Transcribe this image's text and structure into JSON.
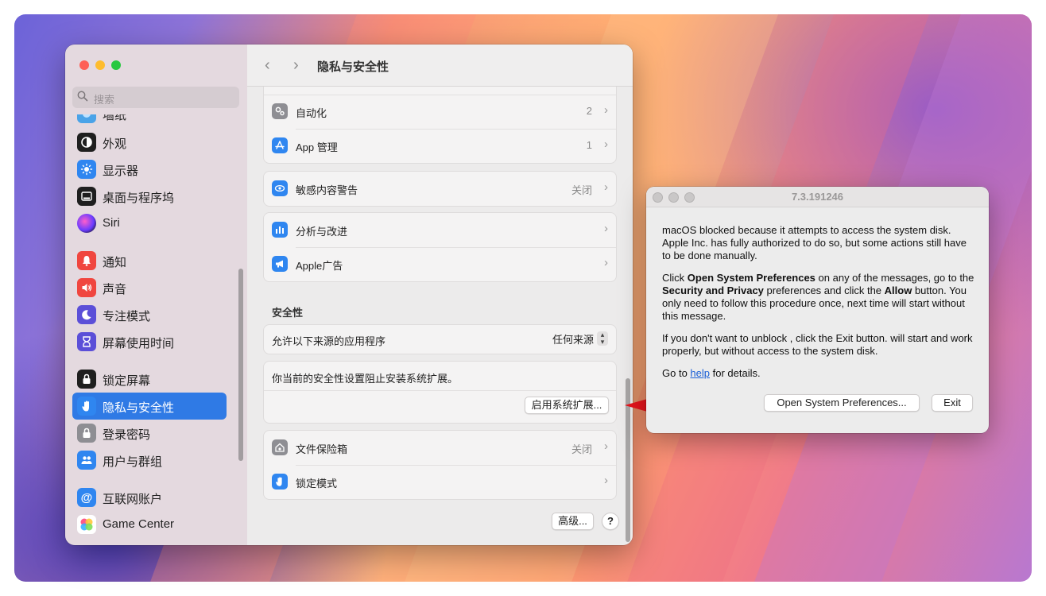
{
  "settings": {
    "search_placeholder": "搜索",
    "window_title": "隐私与安全性",
    "nav_back": "‹",
    "nav_forward": "›",
    "sidebar": {
      "partial_item": "墙纸",
      "items": [
        {
          "label": "外观",
          "icon": "appearance-icon"
        },
        {
          "label": "显示器",
          "icon": "display-icon"
        },
        {
          "label": "桌面与程序坞",
          "icon": "dock-icon"
        },
        {
          "label": "Siri",
          "icon": "siri-icon"
        },
        {
          "label": "通知",
          "icon": "notifications-icon"
        },
        {
          "label": "声音",
          "icon": "sound-icon"
        },
        {
          "label": "专注模式",
          "icon": "focus-icon"
        },
        {
          "label": "屏幕使用时间",
          "icon": "screen-time-icon"
        },
        {
          "label": "锁定屏幕",
          "icon": "lock-screen-icon"
        },
        {
          "label": "隐私与安全性",
          "icon": "privacy-hand-icon",
          "selected": true
        },
        {
          "label": "登录密码",
          "icon": "password-lock-icon"
        },
        {
          "label": "用户与群组",
          "icon": "users-icon"
        },
        {
          "label": "互联网账户",
          "icon": "at-sign-icon"
        },
        {
          "label": "Game Center",
          "icon": "game-center-icon"
        }
      ]
    },
    "rows": {
      "automation": {
        "label": "自动化",
        "value": "2"
      },
      "app_management": {
        "label": "App 管理",
        "value": "1"
      },
      "sensitive_content": {
        "label": "敏感内容警告",
        "value": "关闭"
      },
      "analytics": {
        "label": "分析与改进"
      },
      "apple_ads": {
        "label": "Apple广告"
      },
      "filevault": {
        "label": "文件保险箱",
        "value": "关闭"
      },
      "lockdown": {
        "label": "锁定模式"
      }
    },
    "security": {
      "title": "安全性",
      "allow_label": "允许以下来源的应用程序",
      "allow_value": "任何来源",
      "blocked_message": "你当前的安全性设置阻止安装系统扩展。",
      "enable_button": "启用系统扩展..."
    },
    "advanced_button": "高级...",
    "help_button": "?"
  },
  "dialog": {
    "title": "7.3.191246",
    "para1": "macOS blocked because it attempts to access the system disk. Apple Inc. has fully authorized to do so, but some actions still have to be done manually.",
    "para2": {
      "t1": "Click ",
      "b1": "Open System Preferences",
      "t2": " on any of the messages, go to the ",
      "b2": "Security and Privacy",
      "t3": " preferences and click the ",
      "b3": "Allow",
      "t4": " button. You only need to follow this procedure once, next time will start without this message."
    },
    "para3": "If you don't want to unblock , click the Exit button. will start and work properly, but without access to the system disk.",
    "para4": {
      "before": "Go to ",
      "link": "help",
      "after": " for details."
    },
    "open_button": "Open System Preferences...",
    "exit_button": "Exit"
  },
  "colors": {
    "accent": "#2f7ae5",
    "arrow": "#e8141c",
    "close": "#fe5f57",
    "minimize": "#febc2e",
    "zoom": "#28c840"
  }
}
